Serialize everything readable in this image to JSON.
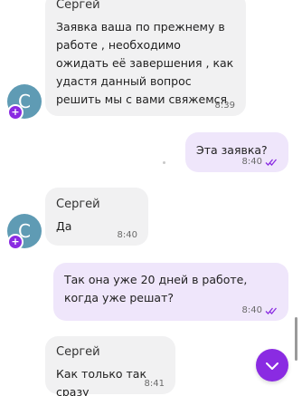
{
  "colors": {
    "accent": "#8a2be2",
    "avatar_bg": "#5f9bb4",
    "incoming_bubble": "#f1f1f2",
    "outgoing_bubble": "#efe6fb",
    "read_ticks": "#8a2be2"
  },
  "avatar": {
    "letter": "С",
    "badge": "+"
  },
  "messages": [
    {
      "direction": "incoming",
      "sender": "Сергей",
      "text": "Заявка ваша по прежнему в работе , необходимо ожидать её завершения , как удастя данный вопрос решить мы с вами свяжемся",
      "time": "8:39"
    },
    {
      "direction": "outgoing",
      "text": "Эта заявка?",
      "time": "8:40",
      "status": "read"
    },
    {
      "direction": "incoming",
      "sender": "Сергей",
      "text": "Да",
      "time": "8:40"
    },
    {
      "direction": "outgoing",
      "text": "Так она уже 20 дней в работе, когда уже решат?",
      "time": "8:40",
      "status": "read"
    },
    {
      "direction": "incoming",
      "sender": "Сергей",
      "text": "Как только так сразу",
      "time": "8:41"
    }
  ],
  "scroll_down_button": {
    "icon": "chevron-down-icon"
  }
}
